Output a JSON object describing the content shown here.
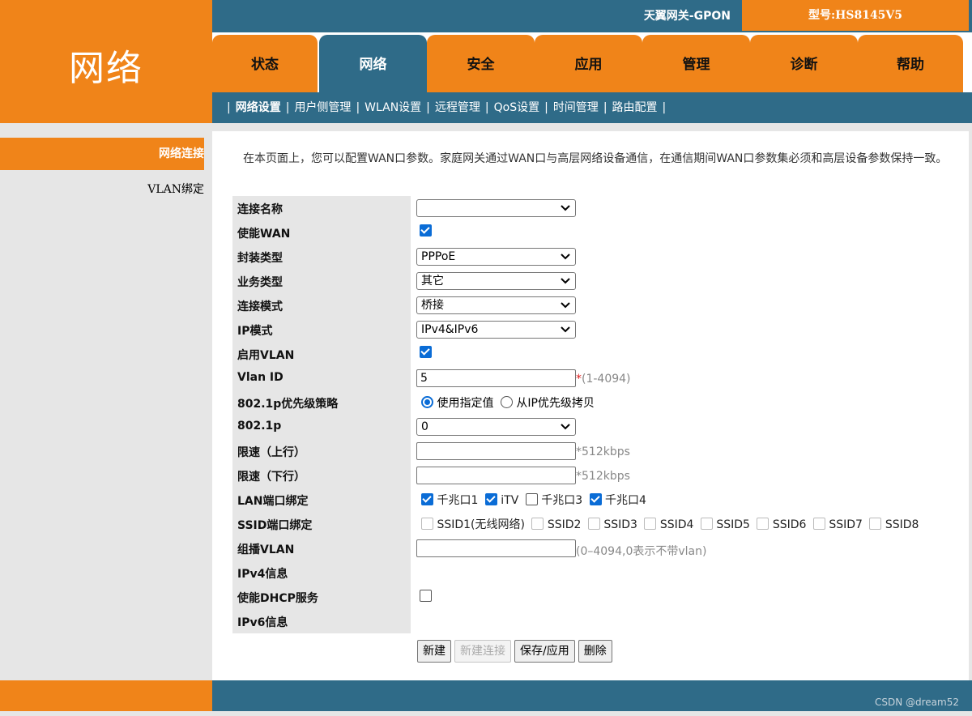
{
  "logo": {
    "text": "网络"
  },
  "header": {
    "gateway_name": "天翼网关-GPON",
    "model": "型号:HS8145V5"
  },
  "nav": {
    "tabs": [
      {
        "label": "状态"
      },
      {
        "label": "网络",
        "active": true
      },
      {
        "label": "安全"
      },
      {
        "label": "应用"
      },
      {
        "label": "管理"
      },
      {
        "label": "诊断"
      },
      {
        "label": "帮助"
      }
    ]
  },
  "subnav": {
    "items": [
      {
        "label": "网络设置",
        "active": true
      },
      {
        "label": "用户侧管理"
      },
      {
        "label": "WLAN设置"
      },
      {
        "label": "远程管理"
      },
      {
        "label": "QoS设置"
      },
      {
        "label": "时间管理"
      },
      {
        "label": "路由配置"
      }
    ],
    "separator": "|"
  },
  "sidebar": {
    "items": [
      {
        "label": "网络连接",
        "active": true
      },
      {
        "label": "VLAN绑定"
      }
    ]
  },
  "intro": "在本页面上，您可以配置WAN口参数。家庭网关通过WAN口与高层网络设备通信，在通信期间WAN口参数集必须和高层设备参数保持一致。",
  "form": {
    "connection_name": {
      "label": "连接名称",
      "value": ""
    },
    "enable_wan": {
      "label": "使能WAN",
      "checked": true
    },
    "encapsulation": {
      "label": "封装类型",
      "value": "PPPoE"
    },
    "service_type": {
      "label": "业务类型",
      "value": "其它"
    },
    "connection_mode": {
      "label": "连接模式",
      "value": "桥接"
    },
    "ip_mode": {
      "label": "IP模式",
      "value": "IPv4&IPv6"
    },
    "enable_vlan": {
      "label": "启用VLAN",
      "checked": true
    },
    "vlan_id": {
      "label": "Vlan ID",
      "value": "5",
      "required": "*",
      "hint": "(1-4094)"
    },
    "priority_policy": {
      "label": "802.1p优先级策略",
      "options": [
        {
          "label": "使用指定值",
          "selected": true
        },
        {
          "label": "从IP优先级拷贝",
          "selected": false
        }
      ]
    },
    "p8021": {
      "label": "802.1p",
      "value": "0"
    },
    "rate_up": {
      "label": "限速（上行）",
      "value": "",
      "hint": "*512kbps"
    },
    "rate_down": {
      "label": "限速（下行）",
      "value": "",
      "hint": "*512kbps"
    },
    "lan_binding": {
      "label": "LAN端口绑定",
      "ports": [
        {
          "label": "千兆口1",
          "checked": true
        },
        {
          "label": "iTV",
          "checked": true
        },
        {
          "label": "千兆口3",
          "checked": false
        },
        {
          "label": "千兆口4",
          "checked": true
        }
      ]
    },
    "ssid_binding": {
      "label": "SSID端口绑定",
      "ssids": [
        {
          "label": "SSID1(无线网络)"
        },
        {
          "label": "SSID2"
        },
        {
          "label": "SSID3"
        },
        {
          "label": "SSID4"
        },
        {
          "label": "SSID5"
        },
        {
          "label": "SSID6"
        },
        {
          "label": "SSID7"
        },
        {
          "label": "SSID8"
        }
      ]
    },
    "multicast_vlan": {
      "label": "组播VLAN",
      "value": "",
      "hint": "(0–4094,0表示不带vlan)"
    },
    "ipv4_info": {
      "label": "IPv4信息"
    },
    "dhcp": {
      "label": "使能DHCP服务",
      "checked": false
    },
    "ipv6_info": {
      "label": "IPv6信息"
    }
  },
  "buttons": {
    "new": "新建",
    "new_connection": "新建连接",
    "save_apply": "保存/应用",
    "delete": "删除"
  },
  "watermark": "CSDN @dream52",
  "colors": {
    "orange": "#f08419",
    "teal": "#2f6b88",
    "checkbox_blue": "#0a6cd6"
  }
}
